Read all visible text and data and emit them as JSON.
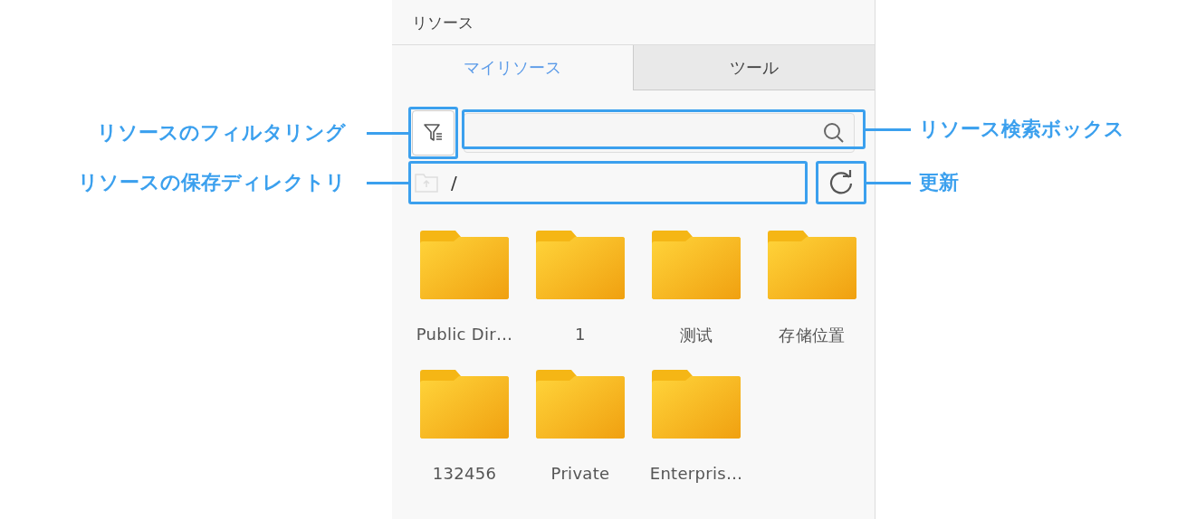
{
  "panel": {
    "title": "リソース"
  },
  "tabs": [
    {
      "label": "マイリソース",
      "selected": true
    },
    {
      "label": "ツール",
      "selected": false
    }
  ],
  "toolbar": {
    "path": "/"
  },
  "folders": [
    {
      "name": "Public Dir…"
    },
    {
      "name": "1"
    },
    {
      "name": "测试"
    },
    {
      "name": "存储位置"
    },
    {
      "name": "132456"
    },
    {
      "name": "Private"
    },
    {
      "name": "Enterpris…"
    }
  ],
  "callouts": {
    "filter": {
      "label": "リソースのフィルタリング"
    },
    "search": {
      "label": "リソース検索ボックス"
    },
    "path": {
      "label": "リソースの保存ディレクトリ"
    },
    "refresh": {
      "label": "更新"
    }
  }
}
